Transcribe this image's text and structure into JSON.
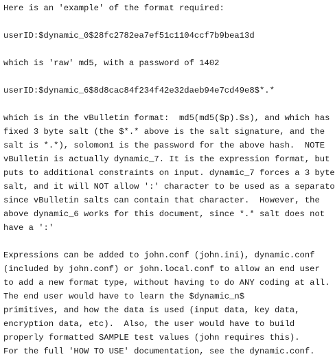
{
  "document": {
    "lines": [
      "Here is an 'example' of the format required:",
      "",
      "userID:$dynamic_0$28fc2782ea7ef51c1104ccf7b9bea13d",
      "",
      "which is 'raw' md5, with a password of 1402",
      "",
      "userID:$dynamic_6$8d8cac84f234f42e32daeb94e7cd49e8$*.*",
      "",
      "which is in the vBulletin format:  md5(md5($p).$s), and which has a",
      "fixed 3 byte salt (the $*.* above is the salt signature, and the",
      "salt is *.*), solomon1 is the password for the above hash.  NOTE",
      "vBulletin is actually dynamic_7. It is the expression format, but",
      "puts to additional constraints on input. dynamic_7 forces a 3 byte",
      "salt, and it will NOT allow ':' character to be used as a separator,",
      "since vBulletin salts can contain that character.  However, the",
      "above dynamic_6 works for this document, since *.* salt does not",
      "have a ':'",
      "",
      "Expressions can be added to john.conf (john.ini), dynamic.conf",
      "(included by john.conf) or john.local.conf to allow an end user",
      "to add a new format type, without having to do ANY coding at all.",
      "The end user would have to learn the $dynamic_n$",
      "primitives, and how the data is used (input data, key data,",
      "encryption data, etc).  Also, the user would have to build",
      "properly formatted SAMPLE test values (john requires this).",
      "For the full 'HOW TO USE' documentation, see the dynamic.conf."
    ]
  }
}
